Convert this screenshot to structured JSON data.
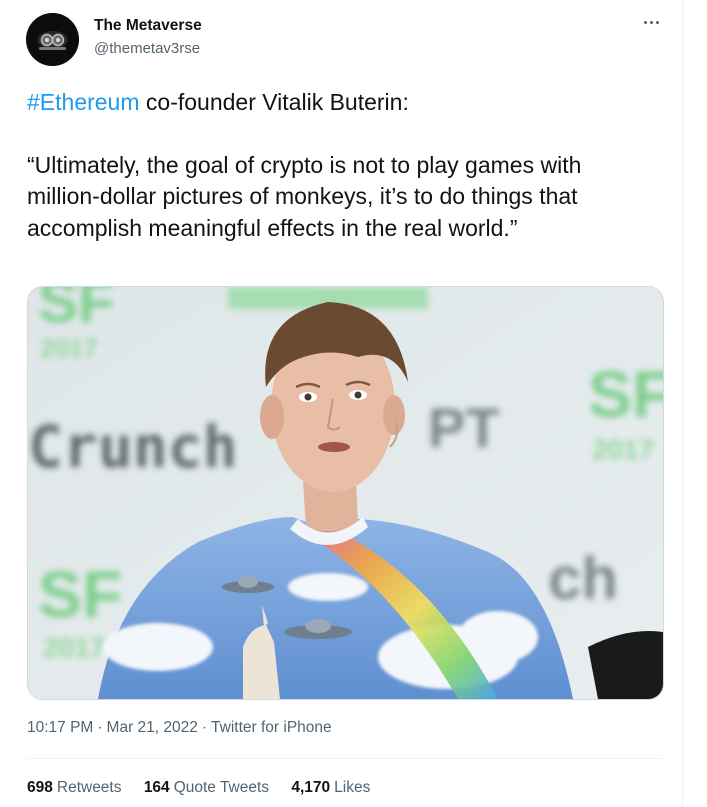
{
  "author": {
    "display_name": "The Metaverse",
    "handle": "@themetav3rse"
  },
  "tweet": {
    "hashtag": "#Ethereum",
    "intro_rest": " co-founder Vitalik Buterin:",
    "quote": "“Ultimately, the goal of crypto is not to play games with million-dollar pictures of monkeys, it’s to do things that accomplish meaningful effects in the real world.”"
  },
  "media": {
    "backdrop_text": [
      "SF",
      "2017",
      "Crunch",
      "PT",
      "SF",
      "2017",
      "ch",
      "SF",
      "2017"
    ],
    "subject": "photo of Vitalik Buterin on TechCrunch stage in a tie-dye sky shirt"
  },
  "meta": {
    "time": "10:17 PM",
    "separator": "·",
    "date": "Mar 21, 2022",
    "source": "Twitter for iPhone"
  },
  "stats": [
    {
      "count": "698",
      "label": "Retweets"
    },
    {
      "count": "164",
      "label": "Quote Tweets"
    },
    {
      "count": "4,170",
      "label": "Likes"
    }
  ],
  "colors": {
    "link": "#1d9bf0",
    "secondary_text": "#536471",
    "primary_text": "#0f1419"
  },
  "icons": [
    "more-icon"
  ]
}
